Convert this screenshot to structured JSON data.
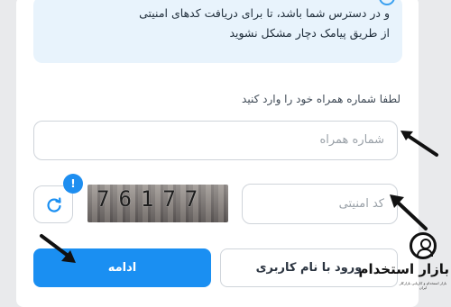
{
  "info": {
    "line1": "و در دسترس شما باشد، تا برای دریافت کدهای امنیتی",
    "line2": "از طریق پیامک دچار مشکل نشوید"
  },
  "phone": {
    "label": "لطفا شماره همراه خود را وارد کنید",
    "placeholder": "شماره همراه"
  },
  "captcha": {
    "placeholder": "کد امنیتی",
    "image_text": "76177",
    "refresh_icon": "refresh-icon",
    "badge": "!"
  },
  "buttons": {
    "continue_label": "ادامه",
    "username_login_label": "ورود با نام کاربری"
  },
  "logo": {
    "text": "بازار استخدام",
    "subtext": "بازار استخدام و کاریابی بازارکار ایران"
  },
  "colors": {
    "primary": "#1a8ff2",
    "info_bg": "#e8f3fc",
    "border": "#cfd4da"
  }
}
